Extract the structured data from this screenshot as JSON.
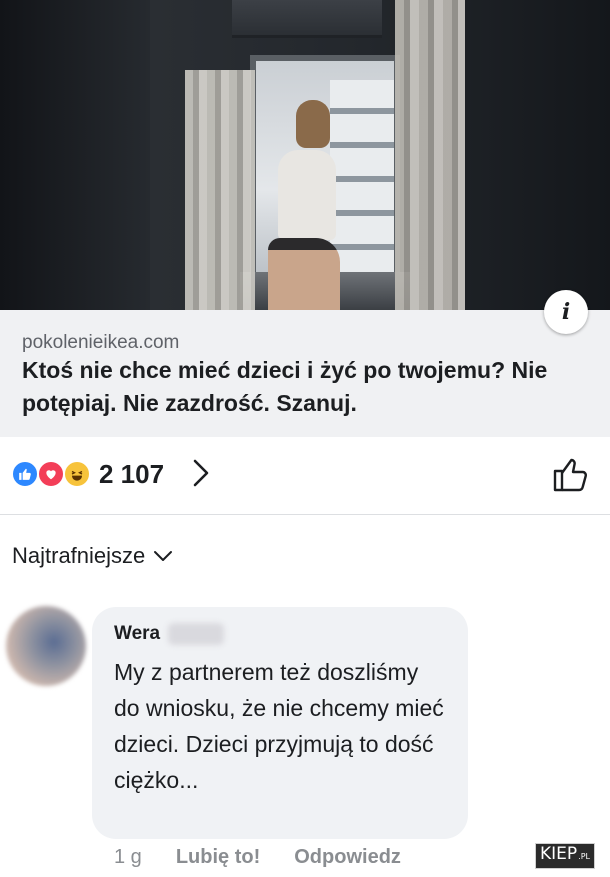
{
  "post": {
    "link_domain": "pokolenieikea.com",
    "link_title": "Ktoś nie chce mieć dzieci i żyć po twojemu? Nie potępiaj. Nie zazdrość. Szanuj.",
    "info_glyph": "i"
  },
  "reactions": {
    "types": [
      "like-icon",
      "love-icon",
      "haha-icon"
    ],
    "count": "2 107"
  },
  "comments_sort": {
    "label": "Najtrafniejsze"
  },
  "comment": {
    "author": "Wera",
    "text": "My z partnerem też doszliśmy do wniosku, że nie chcemy mieć dzieci. Dzieci przyjmują to dość ciężko...",
    "time": "1 g",
    "like_label": "Lubię to!",
    "reply_label": "Odpowiedz"
  },
  "watermark": {
    "text": "KIEP",
    "suffix": ".PL"
  },
  "colors": {
    "like_blue": "#2d88ff",
    "love_red": "#f33e58",
    "haha_yellow": "#f7c33b",
    "meta_gray": "#8a8d91",
    "bubble_bg": "#f0f2f5"
  }
}
